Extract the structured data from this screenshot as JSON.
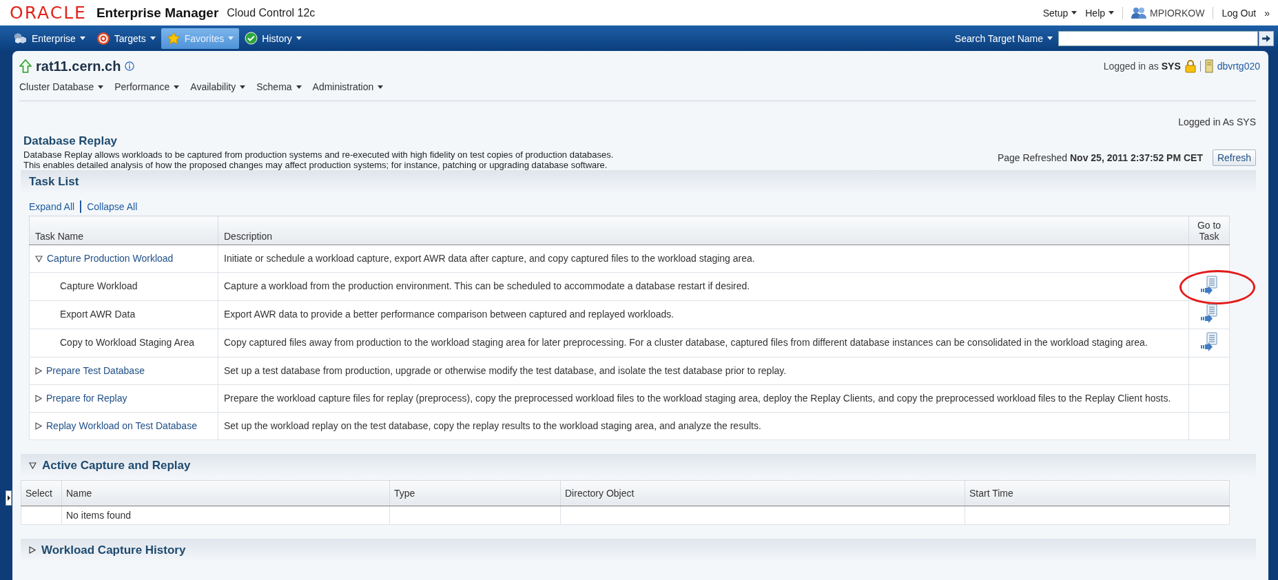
{
  "header": {
    "brand": "ORACLE",
    "product": "Enterprise Manager",
    "edition": "Cloud Control 12c",
    "links": [
      {
        "label": "Setup",
        "kind": "menu"
      },
      {
        "label": "Help",
        "kind": "menu"
      },
      {
        "label": "MPIORKOW",
        "kind": "user"
      },
      {
        "label": "Log Out",
        "kind": "link"
      }
    ],
    "more": "»"
  },
  "navbar": {
    "menus": [
      {
        "label": "Enterprise",
        "kind": "enterprise",
        "selected": false
      },
      {
        "label": "Targets",
        "kind": "targets",
        "selected": false
      },
      {
        "label": "Favorites",
        "kind": "favorites",
        "selected": true
      },
      {
        "label": "History",
        "kind": "history",
        "selected": false
      }
    ],
    "search_scope": "Search Target Name"
  },
  "target": {
    "name": "rat11.cern.ch",
    "login": "Logged in as **SYS**",
    "host": "dbvrtg020",
    "menus": [
      "Cluster Database",
      "Performance",
      "Availability",
      "Schema",
      "Administration"
    ]
  },
  "page": {
    "login_note": "Logged in As SYS",
    "title": "Database Replay",
    "description": [
      "Database Replay allows workloads to be captured from production systems and re-executed with high fidelity on test copies of production databases.",
      "This enables detailed analysis of how the proposed changes may affect production systems; for instance, patching or upgrading database software."
    ],
    "refreshed": "Page Refreshed **Nov 25, 2011 2:37:52 PM CET**",
    "refresh_button": "Refresh"
  },
  "task_list": {
    "title": "Task List",
    "expand_all": "Expand All",
    "collapse_all": "Collapse All",
    "columns": [
      "Task Name",
      "Description",
      "Go to Task"
    ],
    "rows": [
      {
        "name": "Capture Production Workload",
        "description": "Initiate or schedule a workload capture, export AWR data after capture, and copy captured files to the workload staging area.",
        "expanded": true,
        "children": [
          {
            "name": "Capture Workload",
            "description": "Capture a workload from the production environment. This can be scheduled to accommodate a database restart if desired.",
            "circled": true
          },
          {
            "name": "Export AWR Data",
            "description": "Export AWR data to provide a better performance comparison between captured and replayed workloads.",
            "circled": false
          },
          {
            "name": "Copy to Workload Staging Area",
            "description": "Copy captured files away from production to the workload staging area for later preprocessing. For a cluster database, captured files from different database instances can be consolidated in the workload staging area.",
            "circled": false
          }
        ]
      },
      {
        "name": "Prepare Test Database",
        "description": "Set up a test database from production, upgrade or otherwise modify the test database, and isolate the test database prior to replay.",
        "expanded": false
      },
      {
        "name": "Prepare for Replay",
        "description": "Prepare the workload capture files for replay (preprocess), copy the preprocessed workload files to the workload staging area, deploy the Replay Clients, and copy the preprocessed workload files to the Replay Client hosts.",
        "expanded": false
      },
      {
        "name": "Replay Workload on Test Database",
        "description": "Set up the workload replay on the test database, copy the replay results to the workload staging area, and analyze the results.",
        "expanded": false
      }
    ]
  },
  "active_capture": {
    "title": "Active Capture and Replay",
    "expanded": true,
    "columns": [
      "Select",
      "Name",
      "Type",
      "Directory Object",
      "Start Time"
    ],
    "empty_message": "No items found"
  },
  "capture_history": {
    "title": "Workload Capture History",
    "expanded": false
  }
}
